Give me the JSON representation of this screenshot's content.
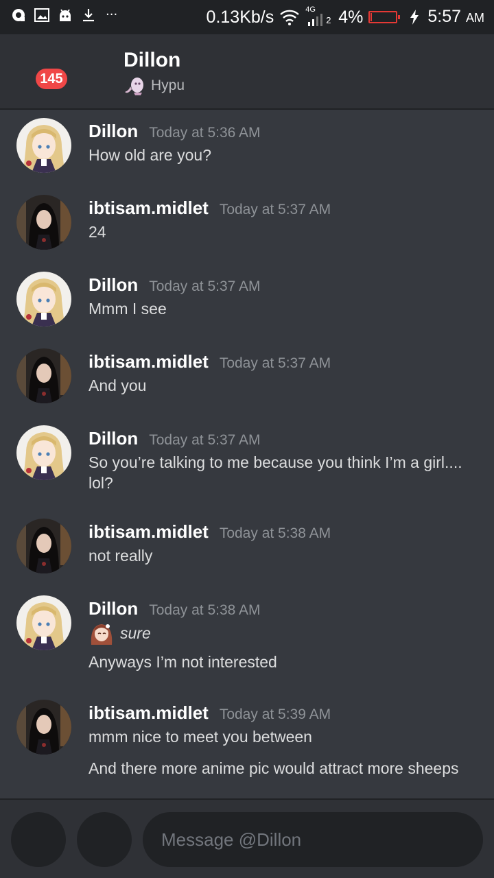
{
  "status_bar": {
    "net_speed": "0.13Kb/s",
    "network_type": "4G",
    "sim_number": "2",
    "battery_percent": "4%",
    "battery_level": 0.04,
    "time": "5:57",
    "ampm": "AM",
    "icons": [
      "sync-icon",
      "image-icon",
      "android-icon",
      "download-icon",
      "more-icon",
      "wifi-icon",
      "signal-icon",
      "battery-icon",
      "charging-icon"
    ]
  },
  "header": {
    "unread_badge": "145",
    "title": "Dillon",
    "subtitle": "Hypu"
  },
  "messages": [
    {
      "author": "Dillon",
      "time": "Today at 5:36 AM",
      "lines": [
        "How old are you?"
      ]
    },
    {
      "author": "ibtisam.midlet",
      "time": "Today at 5:37 AM",
      "lines": [
        "24"
      ]
    },
    {
      "author": "Dillon",
      "time": "Today at 5:37 AM",
      "lines": [
        "Mmm I see"
      ]
    },
    {
      "author": "ibtisam.midlet",
      "time": "Today at 5:37 AM",
      "lines": [
        "And you"
      ]
    },
    {
      "author": "Dillon",
      "time": "Today at 5:37 AM",
      "lines": [
        "So you’re talking to me because you think I’m a girl....",
        "lol?"
      ]
    },
    {
      "author": "ibtisam.midlet",
      "time": "Today at 5:38 AM",
      "lines": [
        "not really"
      ]
    },
    {
      "author": "Dillon",
      "time": "Today at 5:38 AM",
      "emote_text": "sure",
      "lines": [
        "Anyways I’m not interested"
      ]
    },
    {
      "author": "ibtisam.midlet",
      "time": "Today at 5:39 AM",
      "lines": [
        "mmm nice to meet you between",
        "And there more anime pic would attract more sheeps"
      ]
    }
  ],
  "composer": {
    "placeholder": "Message @Dillon"
  },
  "colors": {
    "background": "#36393f",
    "header": "#2f3136",
    "dark": "#202225",
    "badge": "#f04747",
    "muted": "#8e9297"
  }
}
